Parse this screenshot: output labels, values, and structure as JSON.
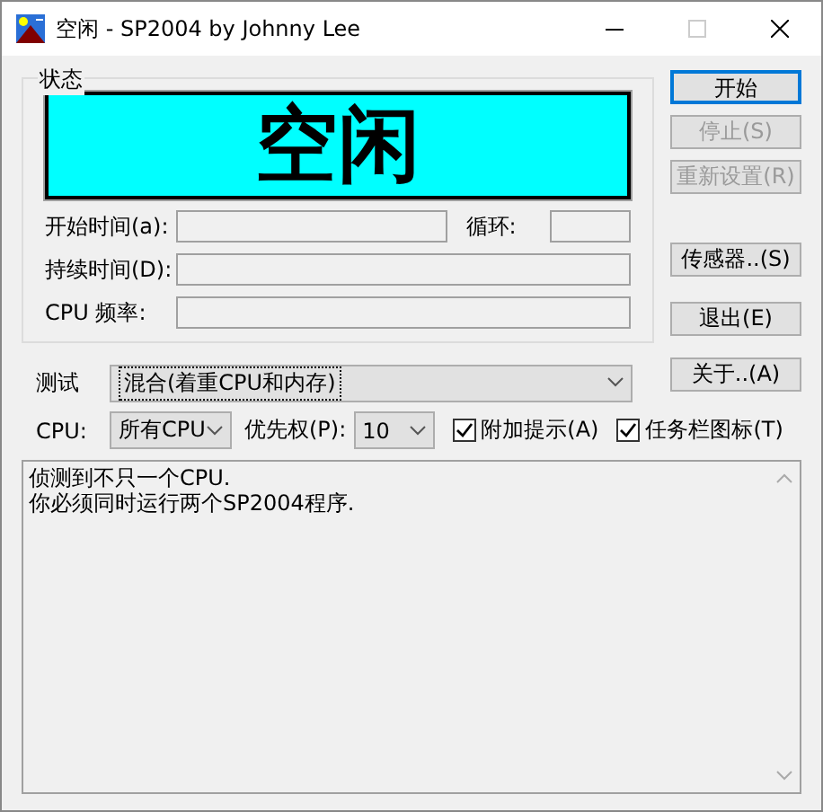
{
  "window": {
    "title": "空闲 - SP2004 by Johnny Lee"
  },
  "status": {
    "title": "状态",
    "display": "空闲",
    "rows": [
      {
        "label": "开始时间(a):",
        "extra_label": "循环:"
      },
      {
        "label": "持续时间(D):"
      },
      {
        "label": "CPU 频率:"
      }
    ]
  },
  "buttons_top": [
    {
      "label": "开始",
      "disabled": false,
      "focused": true
    },
    {
      "label": "停止(S)",
      "disabled": true,
      "focused": false
    },
    {
      "label": "重新设置(R)",
      "disabled": true,
      "focused": false
    }
  ],
  "buttons_middle": [
    {
      "label": "传感器..(S)",
      "disabled": false,
      "focused": false
    },
    {
      "label": "退出(E)",
      "disabled": false,
      "focused": false
    }
  ],
  "test": {
    "label": "测试",
    "value": "混合(着重CPU和内存)",
    "button": {
      "label": "关于..(A)",
      "disabled": false,
      "focused": false
    }
  },
  "cpu": {
    "label": "CPU:",
    "value": "所有CPU"
  },
  "priority": {
    "label": "优先权(P):",
    "value": "10"
  },
  "checkboxes": [
    {
      "label": "附加提示(A)",
      "checked": true
    },
    {
      "label": "任务栏图标(T)",
      "checked": true
    }
  ],
  "log": [
    "侦测到不只一个CPU.",
    "你必须同时运行两个SP2004程序."
  ]
}
